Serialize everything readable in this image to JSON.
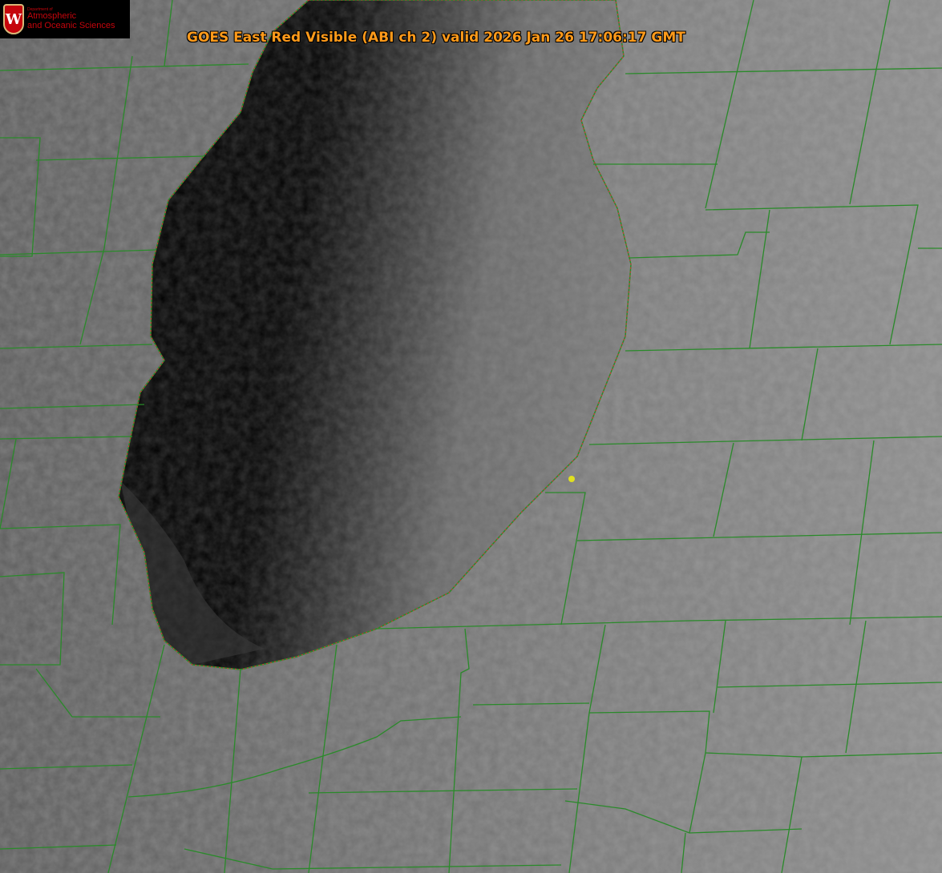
{
  "title": "GOES East Red Visible (ABI ch 2) valid 2026 Jan 26 17:06:17 GMT",
  "logo": {
    "line1": "Department of",
    "line2": "Atmospheric",
    "line3": "and Oceanic Sciences",
    "crest": "W"
  },
  "colors": {
    "title": "#ff9a1a",
    "county_lines": "#2a8a2a",
    "shoreline": "#e03030",
    "marker": "#e0e020",
    "logo_red": "#c5050c"
  }
}
